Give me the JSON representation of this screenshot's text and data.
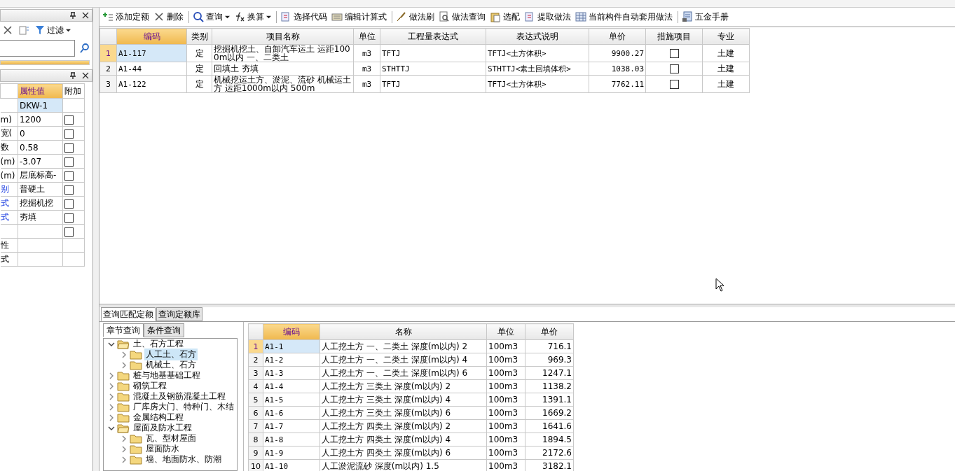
{
  "toolbar": [
    {
      "label": "添加定额",
      "kind": "add",
      "dropdown": false,
      "sep": false
    },
    {
      "label": "删除",
      "kind": "delete",
      "dropdown": false,
      "sep": false
    },
    {
      "label": "查询",
      "kind": "search",
      "dropdown": true,
      "sep": true
    },
    {
      "label": "换算",
      "kind": "fx",
      "dropdown": true,
      "sep": false
    },
    {
      "label": "选择代码",
      "kind": "doc",
      "dropdown": false,
      "sep": true
    },
    {
      "label": "编辑计算式",
      "kind": "keyboard",
      "dropdown": false,
      "sep": false
    },
    {
      "label": "做法刷",
      "kind": "brush",
      "dropdown": false,
      "sep": true
    },
    {
      "label": "做法查询",
      "kind": "search-doc",
      "dropdown": false,
      "sep": false
    },
    {
      "label": "选配",
      "kind": "clipboard",
      "dropdown": false,
      "sep": false
    },
    {
      "label": "提取做法",
      "kind": "doc",
      "dropdown": false,
      "sep": false
    },
    {
      "label": "当前构件自动套用做法",
      "kind": "grid",
      "dropdown": false,
      "sep": false
    },
    {
      "label": "五金手册",
      "kind": "book",
      "dropdown": false,
      "sep": true
    }
  ],
  "left_panel": {
    "filter_label": "过滤",
    "columns": [
      "属性值",
      "附加"
    ],
    "properties": [
      {
        "link": false,
        "value": "DKW-1",
        "selected": true,
        "kind": "plain"
      },
      {
        "name": "m)",
        "link": false,
        "value": "1200",
        "selected": false,
        "kind": "check",
        "checked": false
      },
      {
        "name": "宽(",
        "link": false,
        "value": "0",
        "selected": false,
        "kind": "check",
        "checked": false
      },
      {
        "name": "数",
        "link": false,
        "value": "0.58",
        "selected": false,
        "kind": "check",
        "checked": false
      },
      {
        "name": "(m)",
        "link": false,
        "value": "-3.07",
        "selected": false,
        "kind": "check",
        "checked": false
      },
      {
        "name": "(m)",
        "link": false,
        "value": "层底标高-",
        "selected": false,
        "kind": "check",
        "checked": false
      },
      {
        "name": "别",
        "link": true,
        "value": "普硬土",
        "selected": false,
        "kind": "check",
        "checked": false
      },
      {
        "name": "式",
        "link": true,
        "value": "挖掘机挖",
        "selected": false,
        "kind": "check",
        "checked": false
      },
      {
        "name": "式",
        "link": true,
        "value": "夯填",
        "selected": false,
        "kind": "check",
        "checked": false
      },
      {
        "selected": false,
        "kind": "check",
        "checked": false
      },
      {
        "name": "性",
        "link": false,
        "selected": false,
        "kind": "plain"
      },
      {
        "name": "式",
        "link": false,
        "selected": false,
        "kind": "plain"
      }
    ]
  },
  "main_table": {
    "columns": [
      "编码",
      "类别",
      "项目名称",
      "单位",
      "工程量表达式",
      "表达式说明",
      "单价",
      "措施项目",
      "专业"
    ],
    "rows": [
      {
        "index": "1",
        "code": "A1-117",
        "type": "定",
        "name": "挖掘机挖土、自卸汽车运土 运距1000m以内 一、二类土",
        "unit": "m3",
        "expression": "TFTJ",
        "description": "TFTJ<土方体积>",
        "price": "9900.27",
        "measure": false,
        "specialty": "土建",
        "selected": true
      },
      {
        "index": "2",
        "code": "A1-44",
        "type": "定",
        "name": "回填土 夯填",
        "unit": "m3",
        "expression": "STHTTJ",
        "description": "STHTTJ<素土回填体积>",
        "price": "1038.03",
        "measure": false,
        "specialty": "土建",
        "selected": false
      },
      {
        "index": "3",
        "code": "A1-122",
        "type": "定",
        "name": "机械挖运土方、淤泥、流砂 机械运土方 运距1000m以内 500m",
        "unit": "m3",
        "expression": "TFTJ",
        "description": "TFTJ<土方体积>",
        "price": "7762.11",
        "measure": false,
        "specialty": "土建",
        "selected": false
      }
    ]
  },
  "bottom_tabs": [
    {
      "label": "查询匹配定额",
      "selected": true
    },
    {
      "label": "查询定额库",
      "selected": false
    }
  ],
  "query_tabs": [
    {
      "label": "章节查询",
      "selected": true
    },
    {
      "label": "条件查询",
      "selected": false
    }
  ],
  "chapter_tree": [
    {
      "label": "土、石方工程",
      "expanded": true,
      "selected": false,
      "children": [
        {
          "label": "人工土、石方",
          "expanded": false,
          "selected": true
        },
        {
          "label": "机械土、石方",
          "expanded": false,
          "selected": false
        }
      ]
    },
    {
      "label": "桩与地基基础工程",
      "expanded": false,
      "selected": false
    },
    {
      "label": "砌筑工程",
      "expanded": false,
      "selected": false
    },
    {
      "label": "混凝土及钢筋混凝土工程",
      "expanded": false,
      "selected": false
    },
    {
      "label": "厂库房大门、特种门、木结",
      "expanded": false,
      "selected": false
    },
    {
      "label": "金属结构工程",
      "expanded": false,
      "selected": false
    },
    {
      "label": "屋面及防水工程",
      "expanded": true,
      "selected": false,
      "children": [
        {
          "label": "瓦、型材屋面",
          "expanded": false,
          "selected": false
        },
        {
          "label": "屋面防水",
          "expanded": false,
          "selected": false
        },
        {
          "label": "墙、地面防水、防潮",
          "expanded": false,
          "selected": false
        }
      ]
    }
  ],
  "quota_table": {
    "columns": [
      "编码",
      "名称",
      "单位",
      "单价"
    ],
    "rows": [
      {
        "index": "1",
        "code": "A1-1",
        "name": "人工挖土方 一、二类土 深度(m以内) 2",
        "unit": "100m3",
        "price": "716.1",
        "selected": true
      },
      {
        "index": "2",
        "code": "A1-2",
        "name": "人工挖土方 一、二类土 深度(m以内) 4",
        "unit": "100m3",
        "price": "969.3",
        "selected": false
      },
      {
        "index": "3",
        "code": "A1-3",
        "name": "人工挖土方 一、二类土 深度(m以内) 6",
        "unit": "100m3",
        "price": "1247.1",
        "selected": false
      },
      {
        "index": "4",
        "code": "A1-4",
        "name": "人工挖土方 三类土 深度(m以内) 2",
        "unit": "100m3",
        "price": "1138.2",
        "selected": false
      },
      {
        "index": "5",
        "code": "A1-5",
        "name": "人工挖土方 三类土 深度(m以内) 4",
        "unit": "100m3",
        "price": "1391.1",
        "selected": false
      },
      {
        "index": "6",
        "code": "A1-6",
        "name": "人工挖土方 三类土 深度(m以内) 6",
        "unit": "100m3",
        "price": "1669.2",
        "selected": false
      },
      {
        "index": "7",
        "code": "A1-7",
        "name": "人工挖土方 四类土 深度(m以内) 2",
        "unit": "100m3",
        "price": "1641.6",
        "selected": false
      },
      {
        "index": "8",
        "code": "A1-8",
        "name": "人工挖土方 四类土 深度(m以内) 4",
        "unit": "100m3",
        "price": "1894.5",
        "selected": false
      },
      {
        "index": "9",
        "code": "A1-9",
        "name": "人工挖土方 四类土 深度(m以内) 6",
        "unit": "100m3",
        "price": "2172.6",
        "selected": false
      },
      {
        "index": "10",
        "code": "A1-10",
        "name": "人工淤泥流砂 深度(m以内) 1.5",
        "unit": "100m3",
        "price": "3182.1",
        "selected": false
      }
    ]
  }
}
